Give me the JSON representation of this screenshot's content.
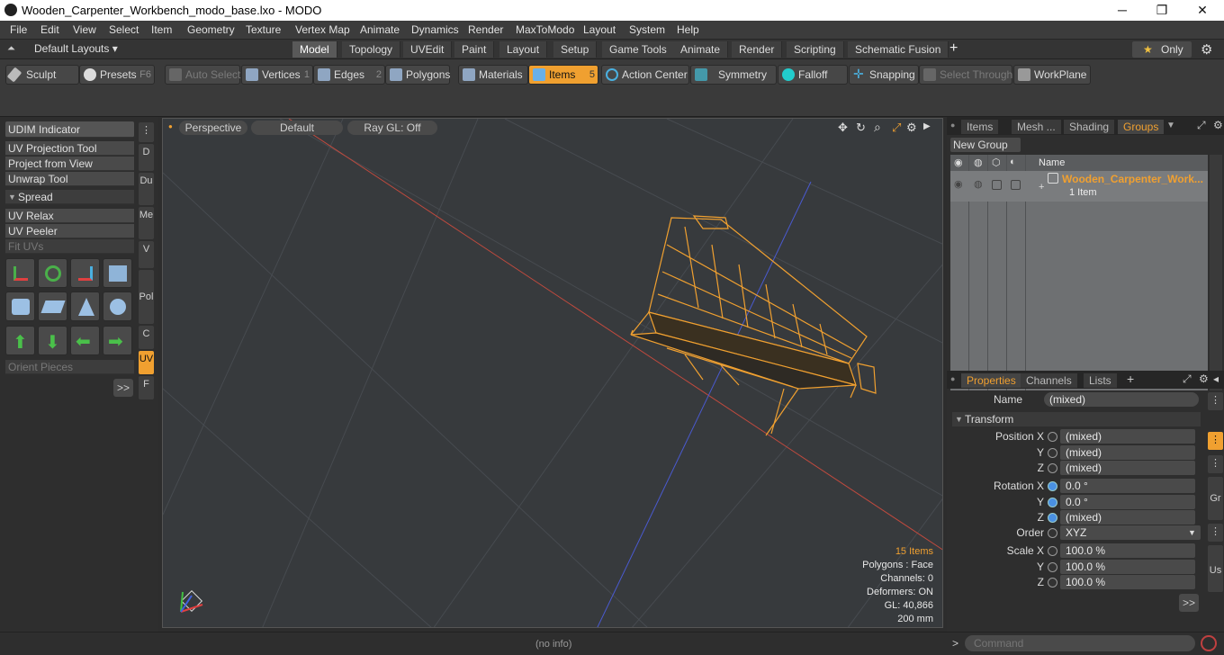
{
  "window": {
    "title": "Wooden_Carpenter_Workbench_modo_base.lxo - MODO",
    "min": "─",
    "max": "❐",
    "close": "✕"
  },
  "menu": [
    "File",
    "Edit",
    "View",
    "Select",
    "Item",
    "Geometry",
    "Texture",
    "Vertex Map",
    "Animate",
    "Dynamics",
    "Render",
    "MaxToModo",
    "Layout",
    "System",
    "Help"
  ],
  "layoutbar": {
    "layouts": "Default Layouts ▾",
    "tabs": [
      "Model",
      "Topology",
      "UVEdit",
      "Paint",
      "Layout",
      "Setup",
      "Game Tools",
      "Animate",
      "Render",
      "Scripting",
      "Schematic Fusion"
    ],
    "add": "+",
    "only": "Only",
    "only_star": "★"
  },
  "toolbar": {
    "sculpt": "Sculpt",
    "presets": "Presets",
    "presets_key": "F6",
    "auto_select": "Auto Select",
    "vertices": "Vertices",
    "vertices_key": "1",
    "edges": "Edges",
    "edges_key": "2",
    "polygons": "Polygons",
    "materials": "Materials",
    "items": "Items",
    "items_key": "5",
    "action_center": "Action Center",
    "symmetry": "Symmetry",
    "falloff": "Falloff",
    "snapping": "Snapping",
    "select_through": "Select Through",
    "workplane": "WorkPlane"
  },
  "leftpanel": {
    "udim": "UDIM Indicator",
    "uv_projection": "UV Projection Tool",
    "project_view": "Project from View",
    "unwrap": "Unwrap Tool",
    "spread": "Spread",
    "uv_relax": "UV Relax",
    "uv_peeler": "UV Peeler",
    "fit_uvs": "Fit UVs",
    "orient": "Orient Pieces",
    "more": ">>",
    "vtabs": [
      "D",
      "Du",
      "Me",
      "V",
      "Pol",
      "C",
      "UV",
      "F"
    ]
  },
  "viewport": {
    "perspective": "Perspective",
    "default": "Default",
    "raygl": "Ray GL: Off",
    "stats": {
      "items": "15 Items",
      "polygons": "Polygons : Face",
      "channels": "Channels: 0",
      "deformers": "Deformers: ON",
      "gl": "GL: 40,866",
      "size": "200 mm"
    }
  },
  "status": {
    "info": "(no info)",
    "command_prompt": ">",
    "command_placeholder": "Command"
  },
  "groups": {
    "tabs": [
      "Items",
      "Mesh ...",
      "Shading",
      "Groups"
    ],
    "new_group": "New Group",
    "col_name": "Name",
    "item_name": "Wooden_Carpenter_Work...",
    "item_count": "1 Item"
  },
  "properties": {
    "tabs": [
      "Properties",
      "Channels",
      "Lists"
    ],
    "add": "+",
    "name_label": "Name",
    "name_value": "(mixed)",
    "transform": "Transform",
    "pos_x_label": "Position X",
    "pos_x": "(mixed)",
    "pos_y_label": "Y",
    "pos_y": "(mixed)",
    "pos_z_label": "Z",
    "pos_z": "(mixed)",
    "rot_x_label": "Rotation X",
    "rot_x": "0.0 °",
    "rot_y_label": "Y",
    "rot_y": "0.0 °",
    "rot_z_label": "Z",
    "rot_z": "(mixed)",
    "order_label": "Order",
    "order": "XYZ",
    "scale_x_label": "Scale X",
    "scale_x": "100.0 %",
    "scale_y_label": "Y",
    "scale_y": "100.0 %",
    "scale_z_label": "Z",
    "scale_z": "100.0 %",
    "more": ">>",
    "side_tabs": [
      "Gr",
      "Us"
    ]
  }
}
